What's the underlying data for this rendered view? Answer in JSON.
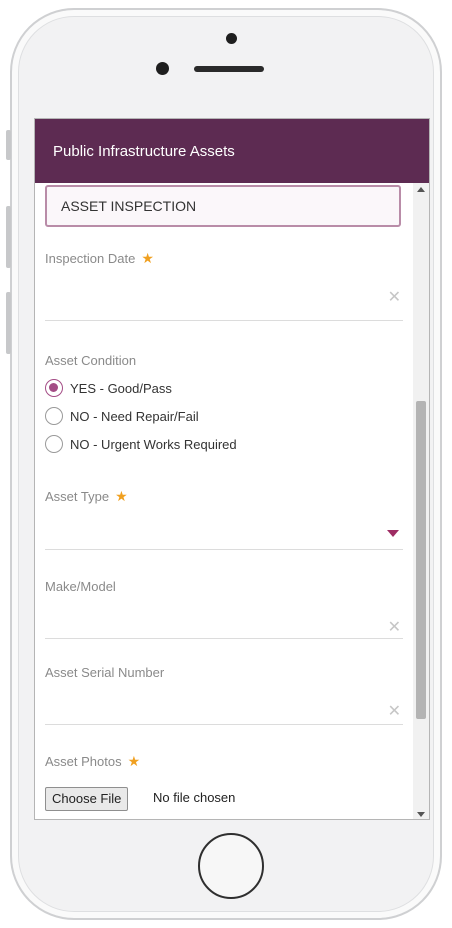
{
  "app": {
    "title": "Public Infrastructure Assets"
  },
  "form": {
    "section_title": "ASSET INSPECTION",
    "inspection_date": {
      "label": "Inspection Date",
      "value": ""
    },
    "asset_condition": {
      "label": "Asset Condition",
      "options": [
        {
          "label": "YES - Good/Pass",
          "checked": true
        },
        {
          "label": "NO - Need Repair/Fail",
          "checked": false
        },
        {
          "label": "NO - Urgent Works Required",
          "checked": false
        }
      ]
    },
    "asset_type": {
      "label": "Asset Type",
      "value": ""
    },
    "make_model": {
      "label": "Make/Model",
      "value": ""
    },
    "serial_number": {
      "label": "Asset Serial Number",
      "value": ""
    },
    "photos": {
      "label": "Asset Photos",
      "button_label": "Choose File",
      "status": "No file chosen"
    }
  },
  "icons": {
    "required": "star-icon",
    "clear": "close-icon",
    "dropdown": "caret-down-icon"
  },
  "colors": {
    "appbar": "#5d2b52",
    "accent": "#a44d86",
    "required_star": "#f0a020",
    "dropdown_arrow": "#9e2c63"
  }
}
